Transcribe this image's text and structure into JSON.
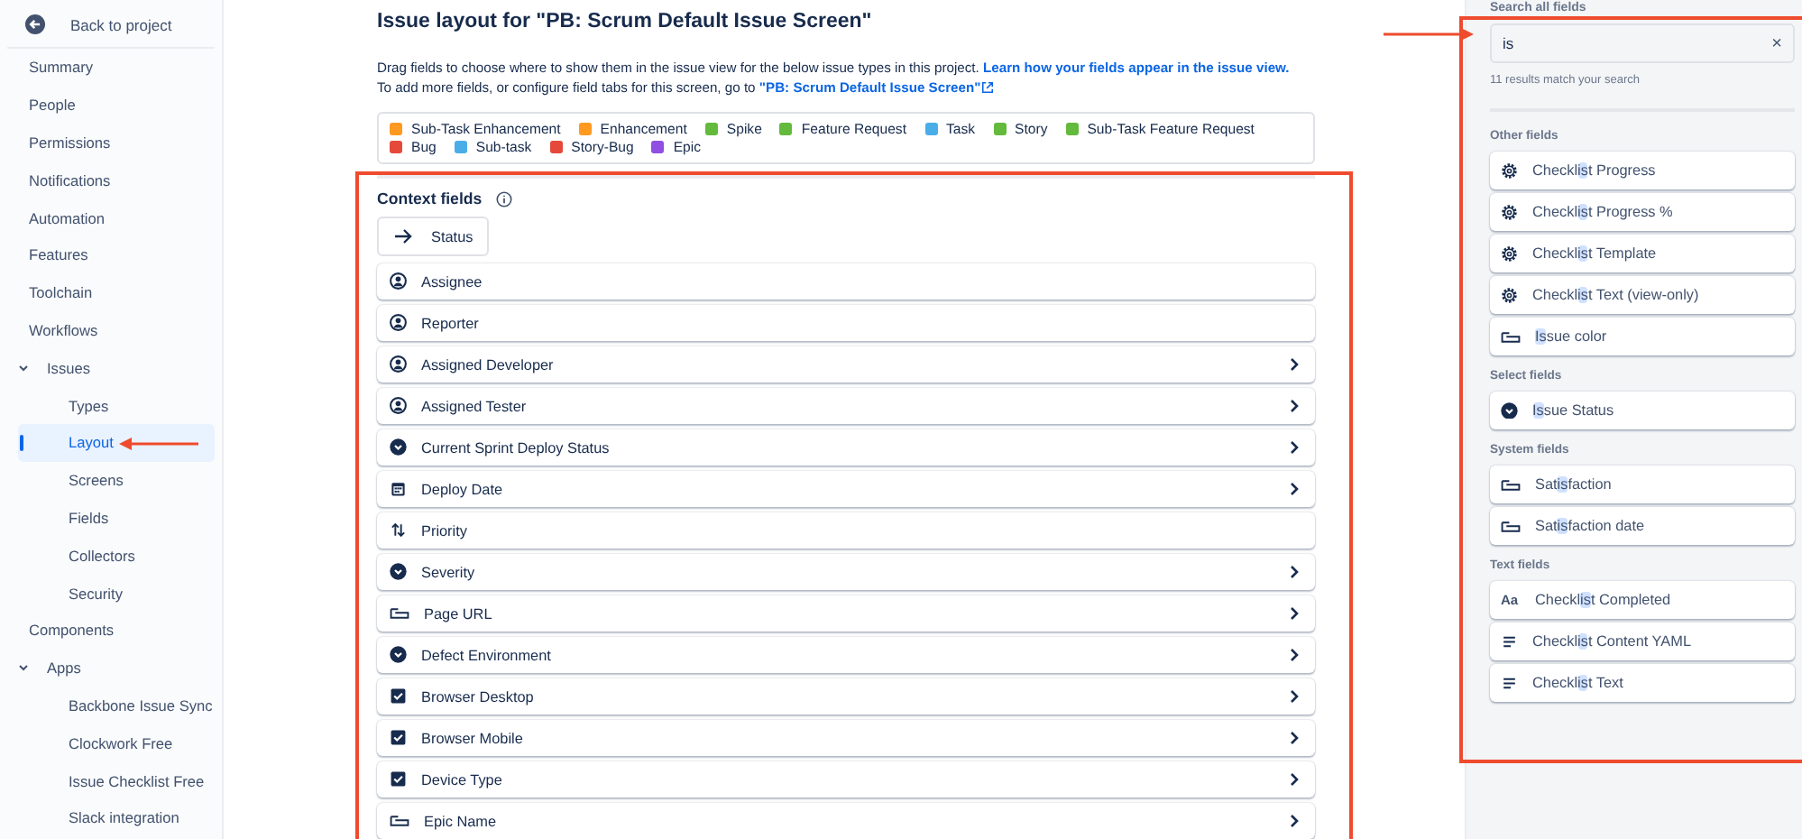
{
  "sidebar": {
    "back_label": "Back to project",
    "items": [
      {
        "label": "Summary",
        "selected": false
      },
      {
        "label": "People",
        "selected": false
      },
      {
        "label": "Permissions",
        "selected": false
      },
      {
        "label": "Notifications",
        "selected": false
      },
      {
        "label": "Automation",
        "selected": false
      },
      {
        "label": "Features",
        "selected": false
      },
      {
        "label": "Toolchain",
        "selected": false
      },
      {
        "label": "Workflows",
        "selected": false
      },
      {
        "label": "Issues",
        "selected": false,
        "expanded": true,
        "children": [
          {
            "label": "Types",
            "selected": false
          },
          {
            "label": "Layout",
            "selected": true
          },
          {
            "label": "Screens",
            "selected": false
          },
          {
            "label": "Fields",
            "selected": false
          },
          {
            "label": "Collectors",
            "selected": false
          },
          {
            "label": "Security",
            "selected": false
          }
        ]
      },
      {
        "label": "Components",
        "selected": false
      },
      {
        "label": "Apps",
        "selected": false,
        "expanded": true,
        "children": [
          {
            "label": "Backbone Issue Sync",
            "selected": false
          },
          {
            "label": "Clockwork Free",
            "selected": false
          },
          {
            "label": "Issue Checklist Free",
            "selected": false
          },
          {
            "label": "Slack integration",
            "selected": false
          }
        ]
      }
    ]
  },
  "main": {
    "title": "Issue layout for \"PB: Scrum Default Issue Screen\"",
    "description": {
      "text": "Drag fields to choose where to show them in the issue view for the below issue types in this project.",
      "link": "Learn how your fields appear in the issue view."
    },
    "screen_line": {
      "text": "To add more fields, or configure field tabs for this screen, go to",
      "link": "\"PB: Scrum Default Issue Screen\""
    },
    "issue_types": [
      {
        "label": "Sub-Task Enhancement",
        "color": "#ff991f"
      },
      {
        "label": "Enhancement",
        "color": "#ff991f"
      },
      {
        "label": "Spike",
        "color": "#63ba3c"
      },
      {
        "label": "Feature Request",
        "color": "#63ba3c"
      },
      {
        "label": "Task",
        "color": "#4bade8"
      },
      {
        "label": "Story",
        "color": "#63ba3c"
      },
      {
        "label": "Sub-Task Feature Request",
        "color": "#63ba3c"
      },
      {
        "label": "Bug",
        "color": "#e5493a"
      },
      {
        "label": "Sub-task",
        "color": "#4bade8"
      },
      {
        "label": "Story-Bug",
        "color": "#e5493a"
      },
      {
        "label": "Epic",
        "color": "#904ee2"
      }
    ],
    "context_fields": {
      "title": "Context fields",
      "status": "Status",
      "fields": [
        {
          "label": "Assignee",
          "kind": "user",
          "expandable": false
        },
        {
          "label": "Reporter",
          "kind": "user",
          "expandable": false
        },
        {
          "label": "Assigned Developer",
          "kind": "user",
          "expandable": true
        },
        {
          "label": "Assigned Tester",
          "kind": "user",
          "expandable": true
        },
        {
          "label": "Current Sprint Deploy Status",
          "kind": "select",
          "expandable": true
        },
        {
          "label": "Deploy Date",
          "kind": "date",
          "expandable": true
        },
        {
          "label": "Priority",
          "kind": "priority",
          "expandable": false
        },
        {
          "label": "Severity",
          "kind": "select",
          "expandable": true
        },
        {
          "label": "Page URL",
          "kind": "textfield",
          "expandable": true
        },
        {
          "label": "Defect Environment",
          "kind": "select",
          "expandable": true
        },
        {
          "label": "Browser Desktop",
          "kind": "checkbox",
          "expandable": true
        },
        {
          "label": "Browser Mobile",
          "kind": "checkbox",
          "expandable": true
        },
        {
          "label": "Device Type",
          "kind": "checkbox",
          "expandable": true
        },
        {
          "label": "Epic Name",
          "kind": "textfield",
          "expandable": true
        }
      ]
    }
  },
  "search_panel": {
    "label": "Search all fields",
    "value": "is",
    "clear": "×",
    "hint": "11 results match your search",
    "groups": [
      {
        "title": "Other fields",
        "items": [
          {
            "before": "Checkl",
            "match": "is",
            "after": "t Progress",
            "kind": "gear"
          },
          {
            "before": "Checkl",
            "match": "is",
            "after": "t Progress %",
            "kind": "gear"
          },
          {
            "before": "Checkl",
            "match": "is",
            "after": "t Template",
            "kind": "gear"
          },
          {
            "before": "Checkl",
            "match": "is",
            "after": "t Text (view-only)",
            "kind": "gear"
          },
          {
            "match": "Is",
            "after": "sue color",
            "kind": "textfield"
          }
        ]
      },
      {
        "title": "Select fields",
        "items": [
          {
            "match": "Is",
            "after": "sue Status",
            "kind": "select"
          }
        ]
      },
      {
        "title": "System fields",
        "items": [
          {
            "before": "Sat",
            "match": "is",
            "after": "faction",
            "kind": "textfield"
          },
          {
            "before": "Sat",
            "match": "is",
            "after": "faction date",
            "kind": "textfield"
          }
        ]
      },
      {
        "title": "Text fields",
        "items": [
          {
            "before": "Checkl",
            "match": "is",
            "after": "t Completed",
            "kind": "text",
            "icon_text": "Aa"
          },
          {
            "before": "Checkl",
            "match": "is",
            "after": "t Content YAML",
            "kind": "paragraph"
          },
          {
            "before": "Checkl",
            "match": "is",
            "after": "t Text",
            "kind": "paragraph"
          }
        ]
      }
    ]
  }
}
